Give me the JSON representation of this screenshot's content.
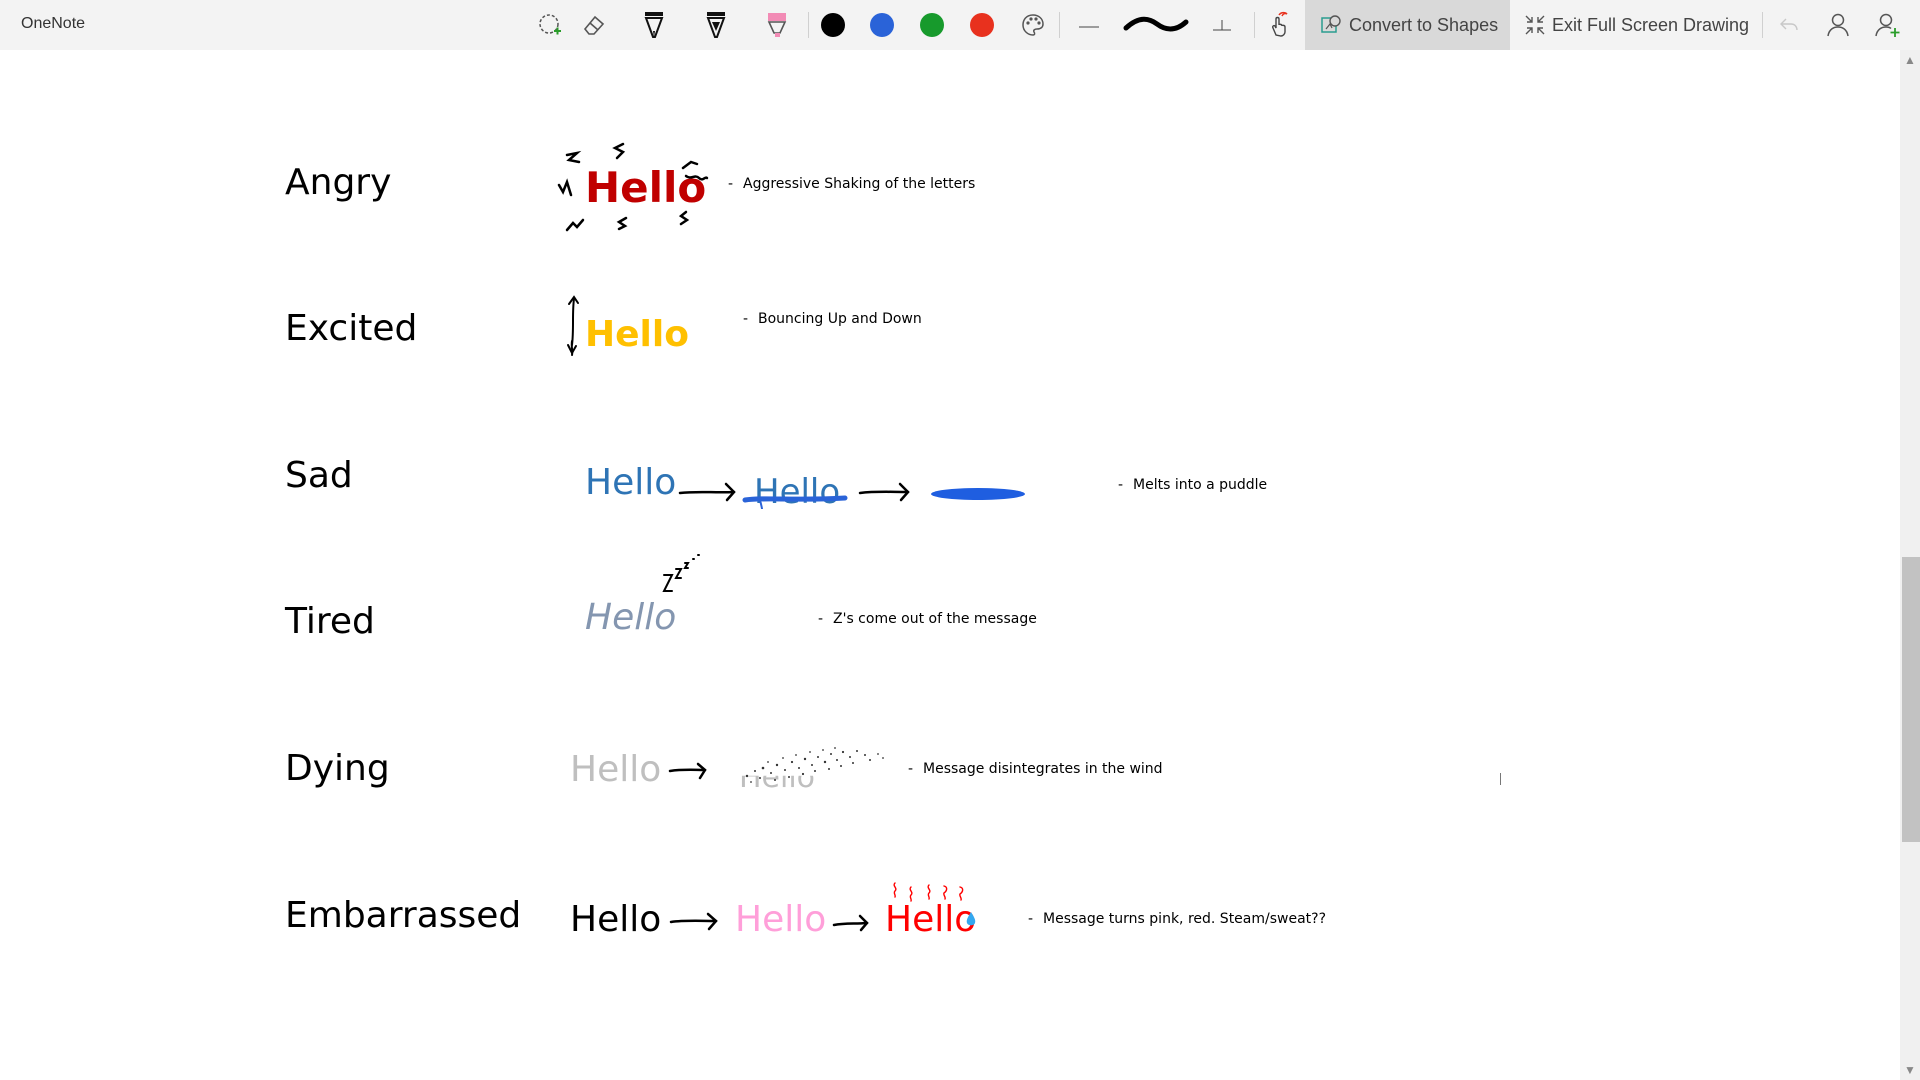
{
  "app": {
    "title": "OneNote"
  },
  "toolbar": {
    "convert_label": "Convert to Shapes",
    "exit_label": "Exit Full Screen Drawing",
    "colors": {
      "black": "#000000",
      "blue": "#2a63d8",
      "green": "#179a2c",
      "red": "#e8311e",
      "highlighter": "#f28bb5"
    }
  },
  "rows": [
    {
      "emotion": "Angry",
      "hello": [
        "Hello"
      ],
      "note": "Aggressive Shaking of the letters",
      "colors": [
        "#c00000"
      ]
    },
    {
      "emotion": "Excited",
      "hello": [
        "Hello"
      ],
      "note": "Bouncing Up and Down",
      "colors": [
        "#ffc000"
      ]
    },
    {
      "emotion": "Sad",
      "hello": [
        "Hello",
        "Hello"
      ],
      "note": "Melts into a puddle",
      "colors": [
        "#2e74b5",
        "#2e74b5"
      ]
    },
    {
      "emotion": "Tired",
      "hello": [
        "Hello"
      ],
      "note": "Z's come out of the message",
      "colors": [
        "#8496b0"
      ]
    },
    {
      "emotion": "Dying",
      "hello": [
        "Hello",
        "Hello"
      ],
      "note": "Message disintegrates in the wind",
      "colors": [
        "#bfbfbf",
        "#bfbfbf"
      ]
    },
    {
      "emotion": "Embarrassed",
      "hello": [
        "Hello",
        "Hello",
        "Hello"
      ],
      "note": "Message turns pink, red. Steam/sweat??",
      "colors": [
        "#000000",
        "#ff9fd9",
        "#ff0000"
      ]
    }
  ],
  "bullet": "-"
}
